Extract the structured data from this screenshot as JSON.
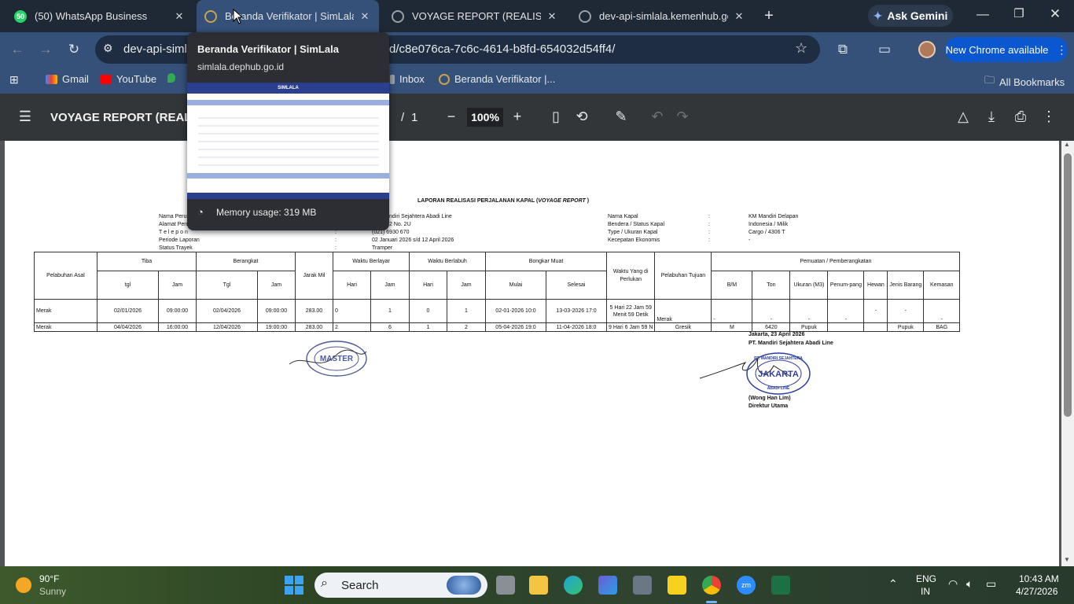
{
  "tabs": [
    {
      "title": "(50) WhatsApp Business",
      "badge": "50",
      "active": false
    },
    {
      "title": "Beranda Verifikator | SimLala",
      "active": true
    },
    {
      "title": "VOYAGE REPORT (REALISASI) no",
      "active": false
    },
    {
      "title": "dev-api-simlala.kemenhub.go.id",
      "active": false
    }
  ],
  "toolbar": {
    "url_start": "dev-api-simla",
    "url_end": "d/c8e076ca-7c6c-4614-b8fd-654032d54ff4/",
    "ask_gemini": "Ask Gemini",
    "new_chrome": "New Chrome available"
  },
  "bookmarks": {
    "items": [
      {
        "label": "Gmail"
      },
      {
        "label": "YouTube"
      },
      {
        "label": "Inbox"
      },
      {
        "label": "Beranda Verifikator |..."
      }
    ],
    "all": "All Bookmarks"
  },
  "hovercard": {
    "title": "Beranda Verifikator | SimLala",
    "domain": "simlala.dephub.go.id",
    "thumb_header": "SIMLALA",
    "memory": "Memory usage: 319 MB"
  },
  "pdf": {
    "title": "VOYAGE REPORT (REALISAS",
    "page_sep": "/",
    "total_pages": "1",
    "zoom": "100%"
  },
  "report": {
    "heading_prefix": "LAPORAN REALISASI PERJALANAN KAPAL (",
    "heading_italic": "VOYAGE REPORT",
    "heading_suffix": " )",
    "left_labels": [
      "Nama Perus",
      "Alamat Peru",
      "T e l e p o n",
      "Periode Laporan",
      "Status Trayek"
    ],
    "left_values": [
      "ndiri Sejahtera Abadi Line",
      "2 No. 2U",
      "(021) 6930 670",
      "02 Januari 2026 s/d 12 April 2026",
      "Tramper"
    ],
    "right_labels": [
      "Nama Kapal",
      "Bendera / Status Kapal",
      "Type / Ukuran Kapal",
      "Kecepatan Ekonomis"
    ],
    "right_values": [
      "KM Mandiri Delapan",
      "Indonesia / Milik",
      "Cargo / 4306 T",
      "-"
    ],
    "colon": ":",
    "headers": {
      "pelabuhan_asal": "Pelabuhan Asal",
      "tiba": "Tiba",
      "berangkat": "Berangkat",
      "jarak": "Jarak Mil",
      "waktu_berlayar": "Waktu Berlayar",
      "waktu_berlabuh": "Waktu Berlabuh",
      "bongkar_muat": "Bongkar Muat",
      "waktu_perlukan": "Waktu Yang di Perlukan",
      "pelabuhan_tujuan": "Pelabuhan Tujuan",
      "pemuatan": "Pemuatan / Pemberangkatan",
      "tgl": "tgl",
      "jam": "Jam",
      "tgl2": "Tgl",
      "hari": "Hari",
      "mulai": "Mulai",
      "selesai": "Selesai",
      "bm": "B/M",
      "ton": "Ton",
      "ukuran": "Ukuran (M3)",
      "penumpang": "Penum-pang",
      "hewan": "Hewan",
      "jenis": "Jenis Barang",
      "kemasan": "Kemasan"
    },
    "rows": [
      {
        "asal": "Merak",
        "tiba_tgl": "02/01/2026",
        "tiba_jam": "09:00:00",
        "brk_tgl": "02/04/2026",
        "brk_jam": "09:00:00",
        "jarak": "283.00",
        "bl_hari": "0",
        "bl_jam": "1",
        "bh_hari": "0",
        "bh_jam": "1",
        "mulai": "02-01-2026 10:0",
        "selesai": "13-03-2026 17:0",
        "waktu": "5 Hari 22 Jam 59 Menit 59 Detik",
        "tujuan": "Merak",
        "bm": "-",
        "ton": "-",
        "ukuran": "-",
        "penumpang": "-",
        "hewan": "-",
        "jenis": "-",
        "kemasan": "-"
      },
      {
        "asal": "Merak",
        "tiba_tgl": "04/04/2026",
        "tiba_jam": "16:00:00",
        "brk_tgl": "12/04/2026",
        "brk_jam": "19:00:00",
        "jarak": "283.00",
        "bl_hari": "2",
        "bl_jam": "6",
        "bh_hari": "1",
        "bh_jam": "2",
        "mulai": "05-04-2026 19:0",
        "selesai": "11-04-2026 18:0",
        "waktu": "9 Hari 6 Jam 59 N",
        "tujuan": "Gresik",
        "bm": "M",
        "ton": "6420",
        "ukuran": "Pupuk",
        "penumpang": "",
        "hewan": "",
        "jenis": "Pupuk",
        "kemasan": "BAG"
      }
    ],
    "place_date": "Jakarta, 23 April 2026",
    "company": "PT. Mandiri Sejahtera Abadi Line",
    "signer": "(Wong Han Lim)",
    "position": "Direktur Utama",
    "stamp_left": "MASTER",
    "stamp_right_city": "JAKARTA",
    "stamp_right_top": "PT. MANDIRI SEJAHTERA",
    "stamp_right_bottom": "ABADI LINE"
  },
  "taskbar": {
    "weather_temp": "90°F",
    "weather_desc": "Sunny",
    "search": "Search",
    "lang1": "ENG",
    "lang2": "IN",
    "time": "10:43 AM",
    "date": "4/27/2026"
  },
  "colors": {
    "tabstrip": "#1f2936",
    "toolbar": "#35517a",
    "pdfbar": "#323639",
    "accent": "#0b57d0"
  }
}
